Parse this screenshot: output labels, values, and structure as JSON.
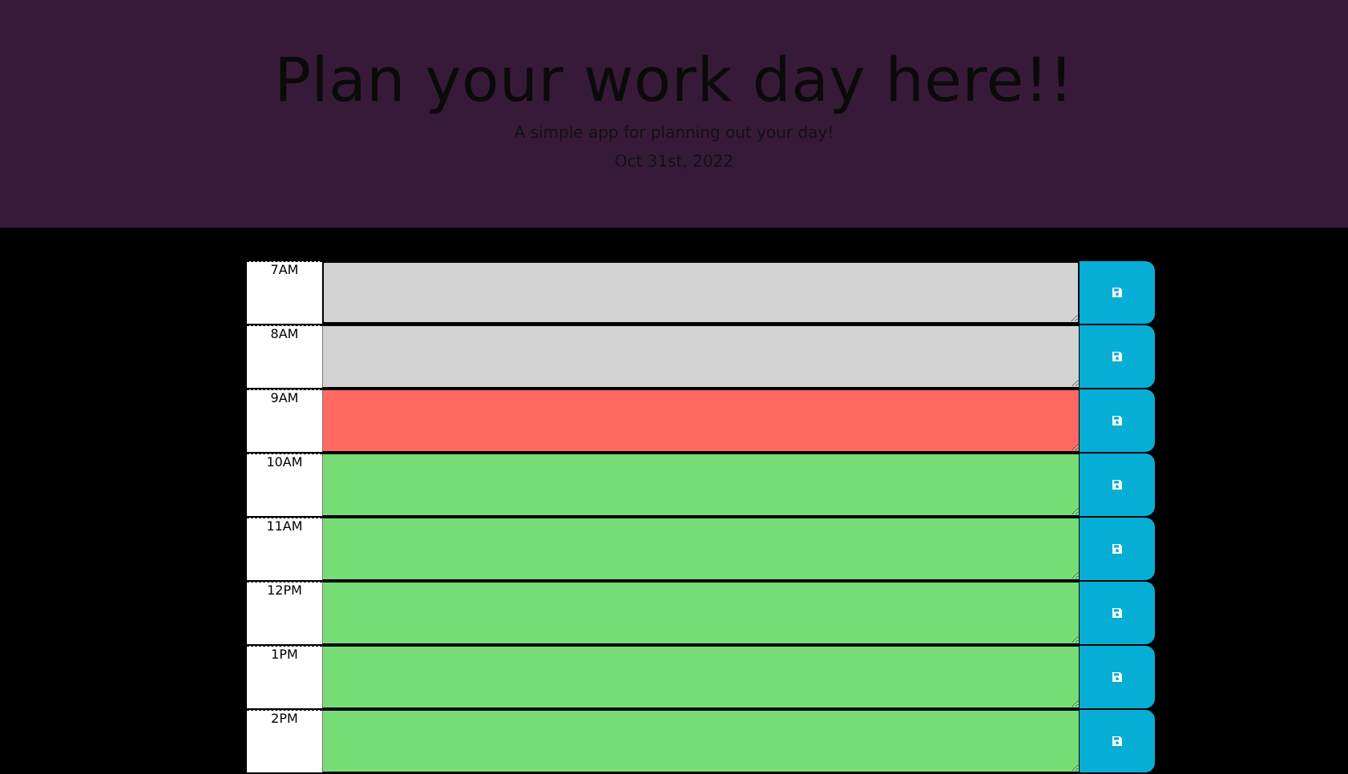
{
  "header": {
    "title": "Plan your work day here!!",
    "subtitle": "A simple app for planning out your day!",
    "date": "Oct 31st, 2022"
  },
  "colors": {
    "past": "#d3d3d3",
    "present": "#ff6961",
    "future": "#77dd77",
    "save_button": "#06aed5",
    "header_bg": "#371a38"
  },
  "rows": [
    {
      "hour": "7AM",
      "status": "past",
      "text": ""
    },
    {
      "hour": "8AM",
      "status": "past",
      "text": ""
    },
    {
      "hour": "9AM",
      "status": "present",
      "text": ""
    },
    {
      "hour": "10AM",
      "status": "future",
      "text": ""
    },
    {
      "hour": "11AM",
      "status": "future",
      "text": ""
    },
    {
      "hour": "12PM",
      "status": "future",
      "text": ""
    },
    {
      "hour": "1PM",
      "status": "future",
      "text": ""
    },
    {
      "hour": "2PM",
      "status": "future",
      "text": ""
    }
  ],
  "icons": {
    "save": "floppy-disk-icon"
  }
}
